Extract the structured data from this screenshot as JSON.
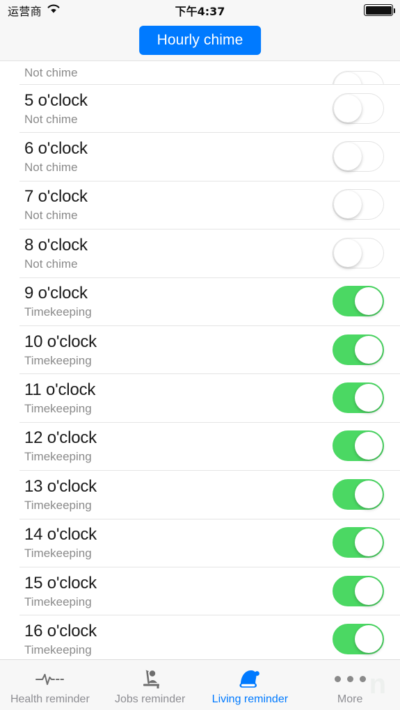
{
  "status_bar": {
    "carrier": "运营商",
    "wifi_icon": "wifi-icon",
    "time": "下午4:37",
    "battery_icon": "battery-full-icon"
  },
  "navbar": {
    "title_button_label": "Hourly chime",
    "accent_color": "#007aff"
  },
  "list": {
    "on_color": "#4bd863",
    "off_color": "#ffffff",
    "rows": [
      {
        "title": "",
        "subtitle": "Not chime",
        "state": "off",
        "partial": true
      },
      {
        "title": "5 o'clock",
        "subtitle": "Not chime",
        "state": "off",
        "partial": false
      },
      {
        "title": "6 o'clock",
        "subtitle": "Not chime",
        "state": "off",
        "partial": false
      },
      {
        "title": "7 o'clock",
        "subtitle": "Not chime",
        "state": "off",
        "partial": false
      },
      {
        "title": "8 o'clock",
        "subtitle": "Not chime",
        "state": "off",
        "partial": false
      },
      {
        "title": "9 o'clock",
        "subtitle": "Timekeeping",
        "state": "on",
        "partial": false
      },
      {
        "title": "10 o'clock",
        "subtitle": "Timekeeping",
        "state": "on",
        "partial": false
      },
      {
        "title": "11 o'clock",
        "subtitle": "Timekeeping",
        "state": "on",
        "partial": false
      },
      {
        "title": "12 o'clock",
        "subtitle": "Timekeeping",
        "state": "on",
        "partial": false
      },
      {
        "title": "13 o'clock",
        "subtitle": "Timekeeping",
        "state": "on",
        "partial": false
      },
      {
        "title": "14 o'clock",
        "subtitle": "Timekeeping",
        "state": "on",
        "partial": false
      },
      {
        "title": "15 o'clock",
        "subtitle": "Timekeeping",
        "state": "on",
        "partial": false
      },
      {
        "title": "16 o'clock",
        "subtitle": "Timekeeping",
        "state": "on",
        "partial": false
      }
    ]
  },
  "tabbar": {
    "active_index": 2,
    "active_color": "#007aff",
    "inactive_color": "#8e8e93",
    "tabs": [
      {
        "label": "Health reminder",
        "icon": "heartbeat-icon",
        "active": false
      },
      {
        "label": "Jobs reminder",
        "icon": "worker-person-icon",
        "active": false
      },
      {
        "label": "Living reminder",
        "icon": "santa-hat-icon",
        "active": true
      },
      {
        "label": "More",
        "icon": "ellipsis-icon",
        "active": false
      }
    ]
  }
}
